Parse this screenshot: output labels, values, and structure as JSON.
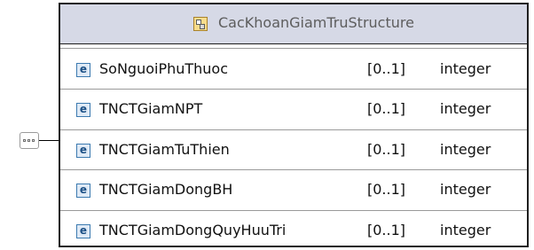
{
  "complex_type": {
    "name": "CacKhoanGiamTruStructure",
    "icon": "complex-type-icon"
  },
  "compositor": {
    "kind": "sequence",
    "icon": "sequence-compositor-icon"
  },
  "elements": [
    {
      "badge": "e",
      "name": "SoNguoiPhuThuoc",
      "occurrence": "[0..1]",
      "type": "integer"
    },
    {
      "badge": "e",
      "name": "TNCTGiamNPT",
      "occurrence": "[0..1]",
      "type": "integer"
    },
    {
      "badge": "e",
      "name": "TNCTGiamTuThien",
      "occurrence": "[0..1]",
      "type": "integer"
    },
    {
      "badge": "e",
      "name": "TNCTGiamDongBH",
      "occurrence": "[0..1]",
      "type": "integer"
    },
    {
      "badge": "e",
      "name": "TNCTGiamDongQuyHuuTri",
      "occurrence": "[0..1]",
      "type": "integer"
    }
  ],
  "colors": {
    "header_bg": "#d6d9e6",
    "border": "#1f1f1f",
    "element_icon": "#3c7ab0"
  }
}
